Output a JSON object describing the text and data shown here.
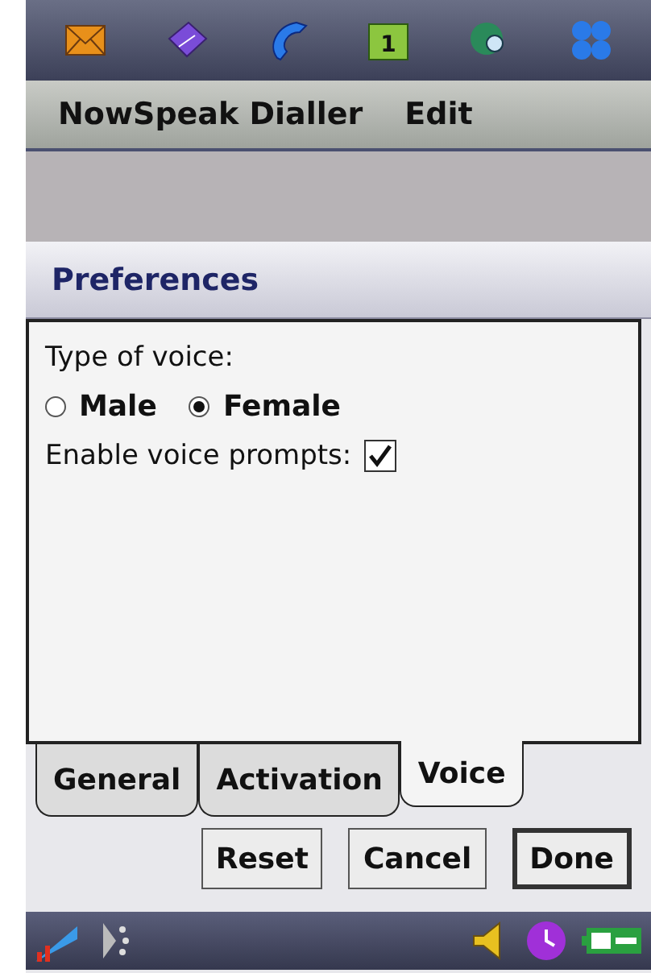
{
  "app_bar": {
    "calendar_day": "1"
  },
  "menu": [
    {
      "label": "NowSpeak Dialler"
    },
    {
      "label": "Edit"
    }
  ],
  "panel": {
    "title": "Preferences",
    "voice_label": "Type of voice:",
    "voices": [
      {
        "label": "Male",
        "selected": false
      },
      {
        "label": "Female",
        "selected": true
      }
    ],
    "prompts": {
      "label": "Enable voice prompts:",
      "checked": true
    }
  },
  "tabs": [
    {
      "label": "General",
      "selected": false
    },
    {
      "label": "Activation",
      "selected": false
    },
    {
      "label": "Voice",
      "selected": true
    }
  ],
  "buttons": [
    {
      "label": "Reset",
      "default": false
    },
    {
      "label": "Cancel",
      "default": false
    },
    {
      "label": "Done",
      "default": true
    }
  ]
}
